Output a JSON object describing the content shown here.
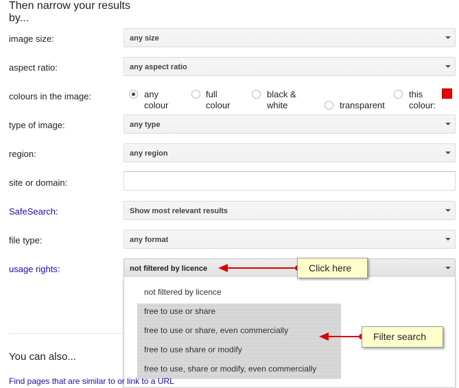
{
  "heading": "Then narrow your results by...",
  "rows": {
    "image_size": {
      "label": "image size:",
      "value": "any size"
    },
    "aspect_ratio": {
      "label": "aspect ratio:",
      "value": "any aspect ratio"
    },
    "colours": {
      "label": "colours in the image:"
    },
    "type_of_image": {
      "label": "type of image:",
      "value": "any type"
    },
    "region": {
      "label": "region:",
      "value": "any region"
    },
    "site_or_domain": {
      "label": "site or domain:",
      "value": ""
    },
    "safesearch": {
      "label": "SafeSearch:",
      "value": "Show most relevant results"
    },
    "file_type": {
      "label": "file type:",
      "value": "any format"
    },
    "usage_rights": {
      "label": "usage rights:",
      "value": "not filtered by licence"
    }
  },
  "colour_options": {
    "any_colour_l1": "any",
    "any_colour_l2": "colour",
    "full_colour_l1": "full",
    "full_colour_l2": "colour",
    "bw_l1": "black &",
    "bw_l2": "white",
    "transparent": "transparent",
    "this_colour_l1": "this",
    "this_colour_l2": "colour:",
    "selected": "any colour",
    "swatch_color": "#ee0000"
  },
  "usage_menu": {
    "items": [
      "not filtered by licence",
      "free to use or share",
      "free to use or share, even commercially",
      "free to use share or modify",
      "free to use, share or modify, even commercially"
    ]
  },
  "callouts": {
    "click_here": "Click here",
    "filter_search": "Filter search",
    "arrow_color": "#dd0000"
  },
  "footer": {
    "you_can_also": "You can also...",
    "find_pages": "Find pages that are similar to or link to a URL"
  }
}
